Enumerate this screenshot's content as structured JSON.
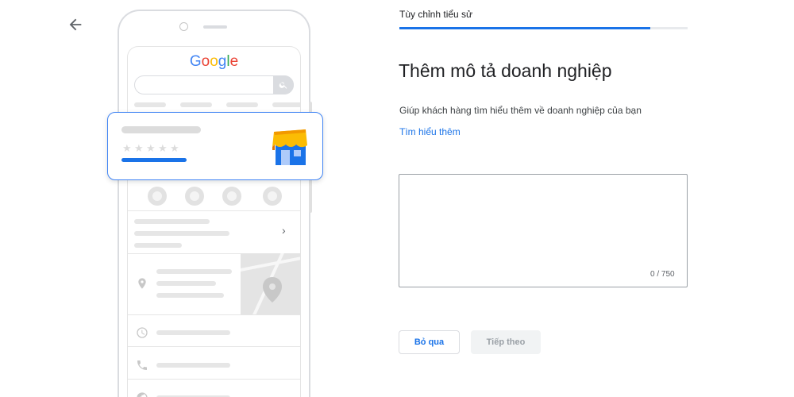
{
  "header": {
    "step_title": "Tùy chỉnh tiểu sử",
    "progress_fraction": 0.87
  },
  "main": {
    "heading": "Thêm mô tả doanh nghiệp",
    "subtitle": "Giúp khách hàng tìm hiểu thêm về doanh nghiệp của bạn",
    "learn_more_link": "Tìm hiểu thêm",
    "description": {
      "value": "",
      "counter": "0 / 750"
    }
  },
  "actions": {
    "skip_label": "Bỏ qua",
    "next_label": "Tiếp theo"
  },
  "illustration": {
    "logo_text": "Google",
    "logo_colors": [
      "#4285f4",
      "#ea4335",
      "#fbbc05",
      "#4285f4",
      "#34a853",
      "#ea4335"
    ],
    "card_star_glyph": "★",
    "chevron_glyph": "›",
    "accent_color": "#1a73e8"
  },
  "icons": {
    "back": "arrow-left-icon",
    "search": "search-icon",
    "store": "storefront-icon",
    "phone": "phone-icon",
    "directions": "directions-icon",
    "save": "bookmark-icon",
    "share": "share-icon",
    "location": "location-pin-icon",
    "clock": "clock-icon",
    "globe": "globe-icon"
  }
}
